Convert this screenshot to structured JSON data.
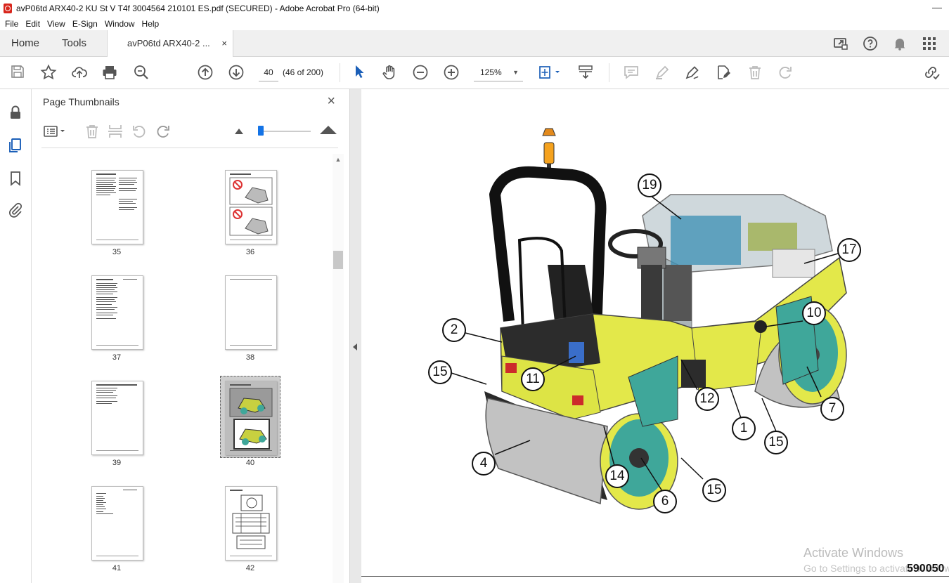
{
  "window": {
    "title": "avP06td ARX40-2 KU St V T4f 3004564 210101 ES.pdf (SECURED) - Adobe Acrobat Pro (64-bit)",
    "controls": "—"
  },
  "menu": [
    "File",
    "Edit",
    "View",
    "E-Sign",
    "Window",
    "Help"
  ],
  "tabs": {
    "home": "Home",
    "tools": "Tools",
    "document": "avP06td ARX40-2 ...",
    "close": "×"
  },
  "toolbar": {
    "page_input": "40",
    "page_count": "(46 of 200)",
    "zoom": "125%"
  },
  "panel": {
    "title": "Page Thumbnails",
    "close": "×",
    "thumbnails": [
      {
        "label": "35"
      },
      {
        "label": "36"
      },
      {
        "label": "37"
      },
      {
        "label": "38"
      },
      {
        "label": "39"
      },
      {
        "label": "40"
      },
      {
        "label": "41"
      },
      {
        "label": "42"
      }
    ]
  },
  "document": {
    "callouts": [
      "19",
      "17",
      "10",
      "2",
      "15",
      "11",
      "12",
      "7",
      "1",
      "15",
      "4",
      "14",
      "6",
      "15"
    ],
    "page_code": "590050"
  },
  "watermark": {
    "line1": "Activate Windows",
    "line2": "Go to Settings to activate Windows."
  },
  "colors": {
    "accent": "#1473e6",
    "pdf_red": "#d8261c",
    "machine_yellow": "#e3e84a",
    "machine_teal": "#3fa79a"
  }
}
